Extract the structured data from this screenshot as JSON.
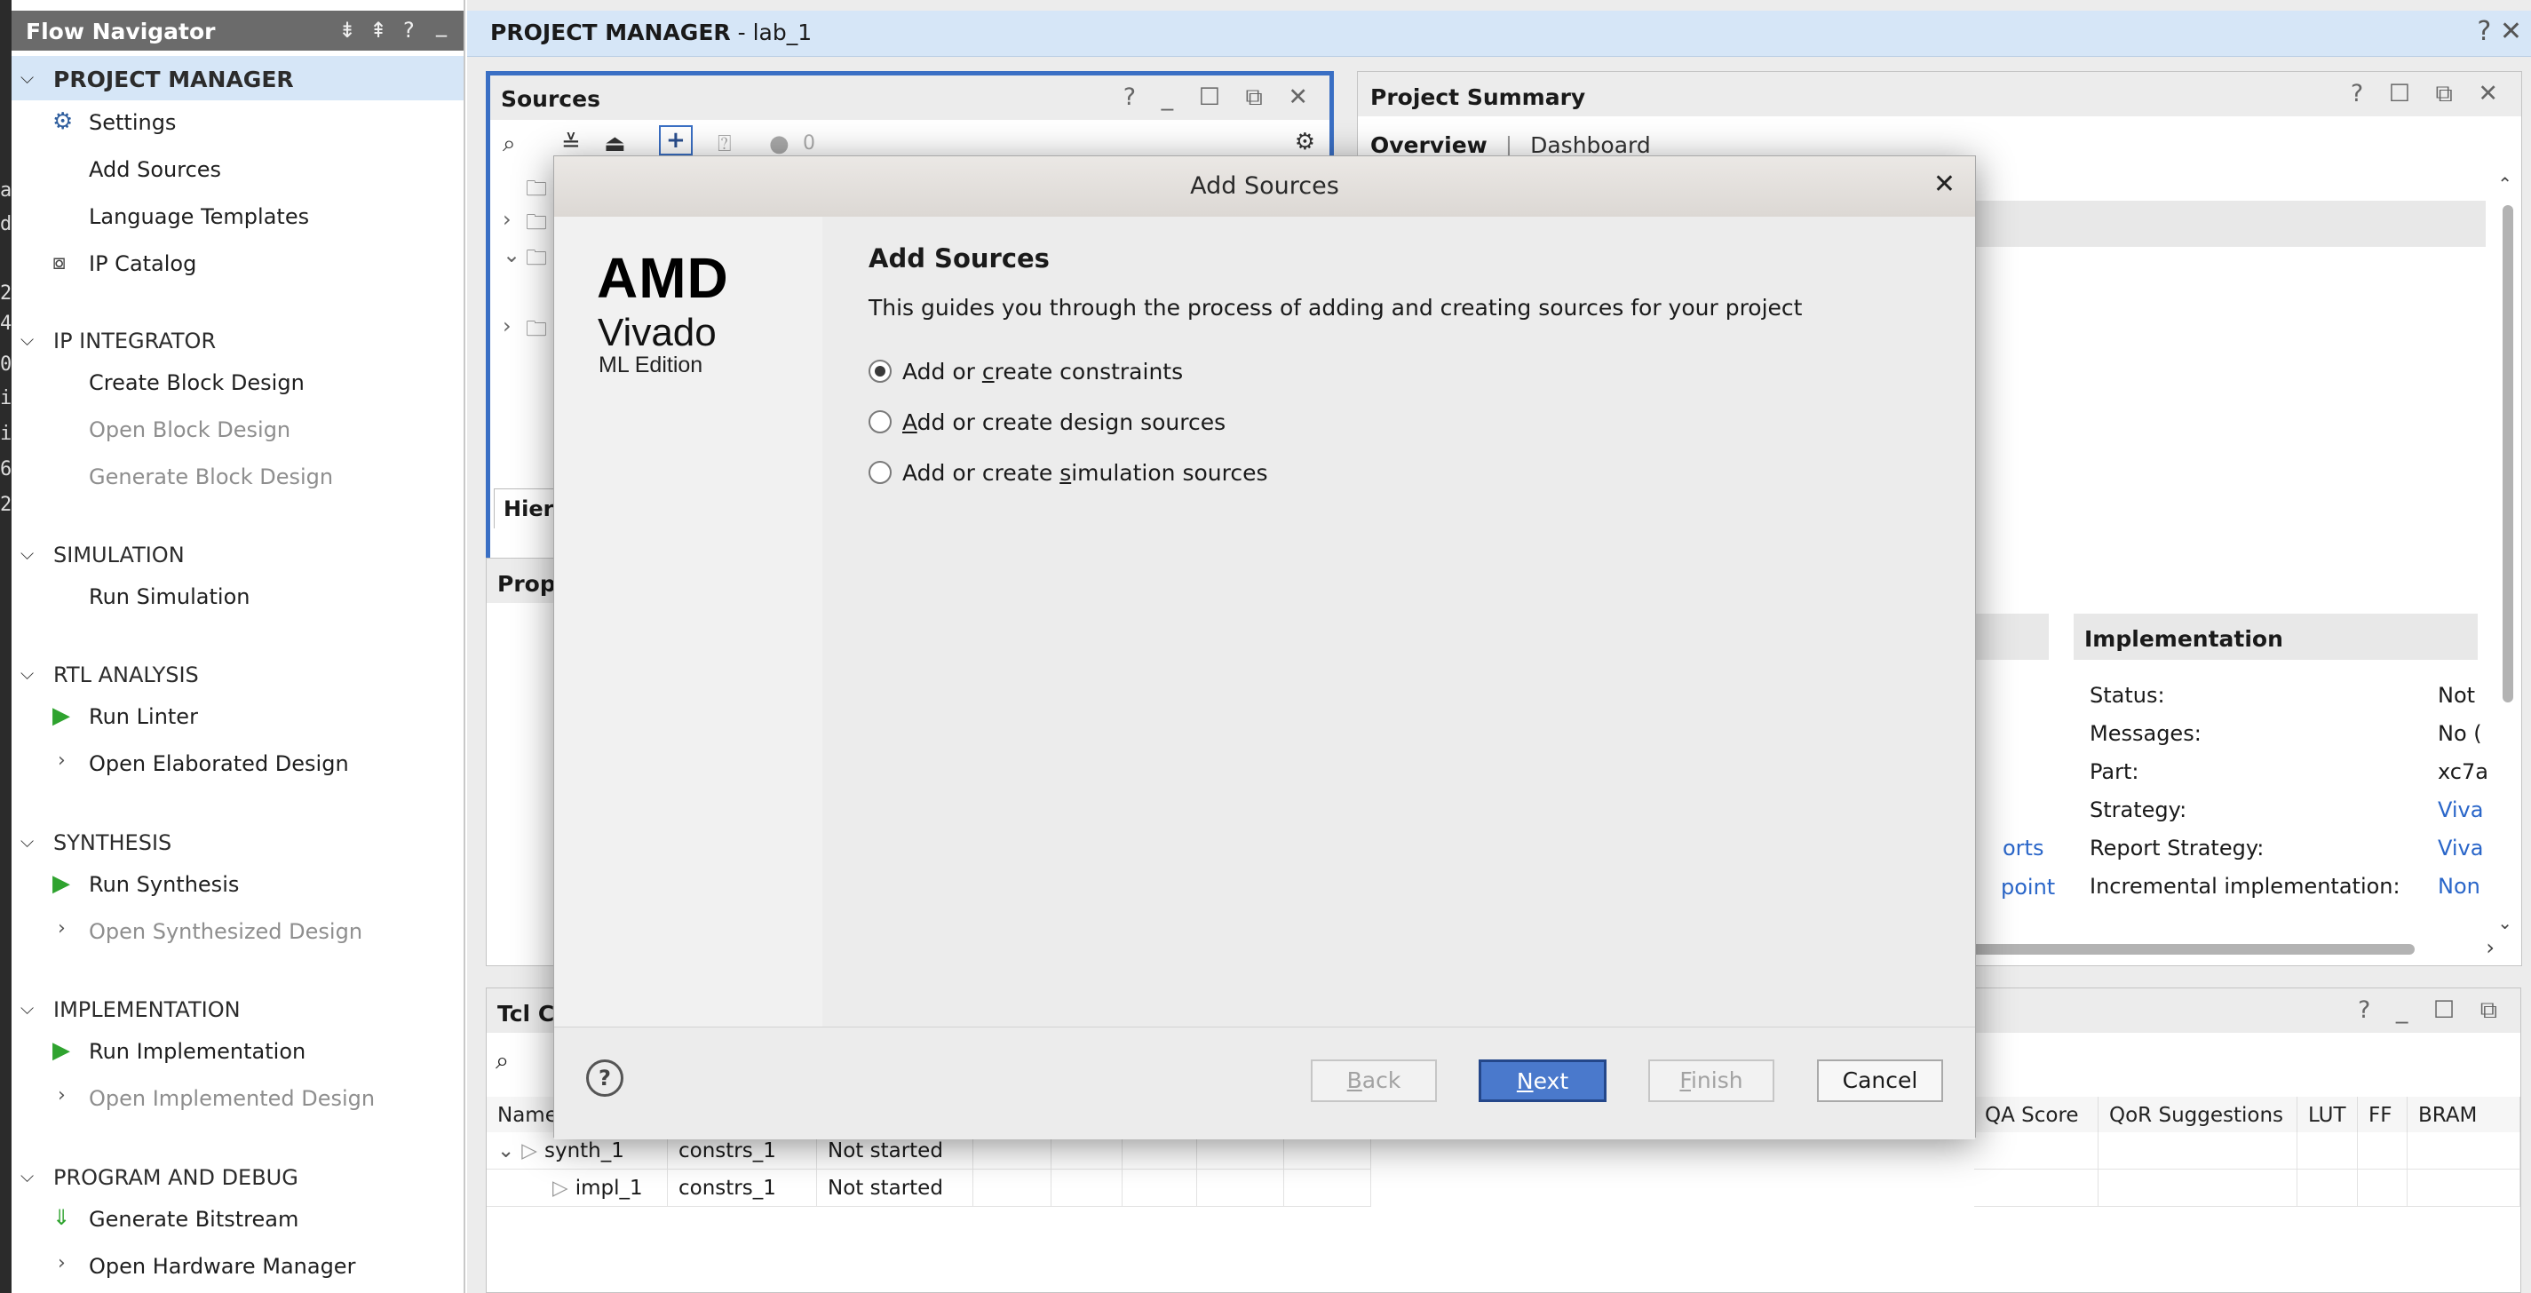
{
  "edge_chars": [
    "a",
    "d",
    "",
    "2",
    "4",
    "0",
    "i",
    "i",
    "6",
    "2"
  ],
  "flow_navigator": {
    "title": "Flow Navigator",
    "header_icons": [
      "⇟",
      "⇞",
      "?",
      "_"
    ],
    "sections": [
      {
        "label": "PROJECT MANAGER",
        "items": [
          "Settings",
          "Add Sources",
          "Language Templates",
          "IP Catalog"
        ]
      },
      {
        "label": "IP INTEGRATOR",
        "items": [
          "Create Block Design",
          "Open Block Design",
          "Generate Block Design"
        ]
      },
      {
        "label": "SIMULATION",
        "items": [
          "Run Simulation"
        ]
      },
      {
        "label": "RTL ANALYSIS",
        "items": [
          "Run Linter",
          "Open Elaborated Design"
        ]
      },
      {
        "label": "SYNTHESIS",
        "items": [
          "Run Synthesis",
          "Open Synthesized Design"
        ]
      },
      {
        "label": "IMPLEMENTATION",
        "items": [
          "Run Implementation",
          "Open Implemented Design"
        ]
      },
      {
        "label": "PROGRAM AND DEBUG",
        "items": [
          "Generate Bitstream",
          "Open Hardware Manager"
        ]
      }
    ]
  },
  "project_bar": {
    "label": "PROJECT MANAGER",
    "project": " - lab_1",
    "tools": "? ✕"
  },
  "sources": {
    "title": "Sources",
    "tools": "? _ ☐ ⧉ ✕",
    "toolbar": "🔍 ≚ ≙ ✚ ⍰ ● 0",
    "count": "0",
    "hier_tab": "Hier"
  },
  "properties": {
    "title": "Prop"
  },
  "summary": {
    "title": "Project Summary",
    "tools": "? ☐ ⧉ ✕",
    "tab_overview": "Overview",
    "tab_sep": "|",
    "tab_dashboard": "Dashboard",
    "impl_header": "Implementation",
    "left_links": [
      "orts",
      "point"
    ],
    "rows": [
      {
        "k": "Status:",
        "v": "Not"
      },
      {
        "k": "Messages:",
        "v": "No ("
      },
      {
        "k": "Part:",
        "v": "xc7a"
      },
      {
        "k": "Strategy:",
        "v": "Viva"
      },
      {
        "k": "Report Strategy:",
        "v": "Viva"
      },
      {
        "k": "Incremental implementation:",
        "v": "Non"
      }
    ]
  },
  "runs": {
    "title": "Tcl C",
    "tools": "? _ ☐ ⧉",
    "columns_left": [
      "Name"
    ],
    "columns_right": [
      "QA Score",
      "QoR Suggestions",
      "LUT",
      "FF",
      "BRAM"
    ],
    "rows": [
      {
        "name": "synth_1",
        "constraints": "constrs_1",
        "status": "Not started"
      },
      {
        "name": "impl_1",
        "constraints": "constrs_1",
        "status": "Not started"
      }
    ]
  },
  "dialog": {
    "title": "Add Sources",
    "close": "✕",
    "brand": {
      "company": "AMD",
      "product": "Vivado",
      "edition": "ML Edition"
    },
    "heading": "Add Sources",
    "description": "This guides you through the process of adding and creating sources for your project",
    "options": [
      {
        "pre": "Add or ",
        "mn": "c",
        "post": "reate constraints",
        "selected": true
      },
      {
        "pre": "",
        "mn": "A",
        "post": "dd or create design sources",
        "selected": false
      },
      {
        "pre": "Add or create ",
        "mn": "s",
        "post": "imulation sources",
        "selected": false
      }
    ],
    "help": "?",
    "buttons": {
      "back": {
        "mn": "B",
        "rest": "ack"
      },
      "next": {
        "mn": "N",
        "rest": "ext"
      },
      "finish": {
        "mn": "F",
        "rest": "inish"
      },
      "cancel": "Cancel"
    }
  }
}
